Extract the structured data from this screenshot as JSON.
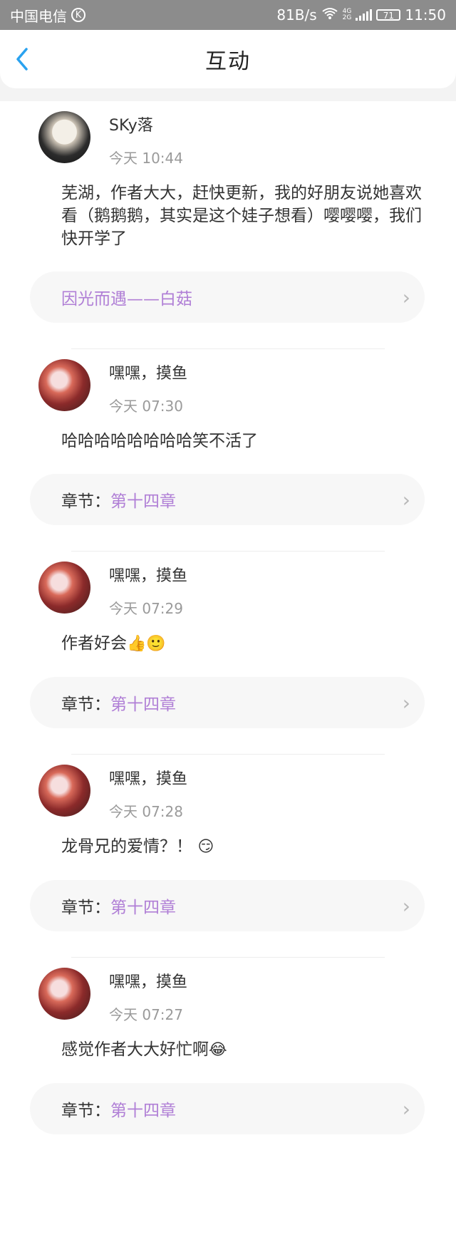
{
  "status_bar": {
    "carrier": "中国电信",
    "carrier_icon": "K",
    "speed": "81B/s",
    "network": "4G",
    "network2": "2G",
    "battery": "71",
    "time": "11:50",
    "colors": {
      "background": "#8c8c8c",
      "text": "#ffffff"
    }
  },
  "header": {
    "title": "互动",
    "back_icon": "chevron-left-icon",
    "accent": "#2aa2ef"
  },
  "comments": [
    {
      "user": "SKy落",
      "time": "今天 10:44",
      "text": "芜湖，作者大大，赶快更新，我的好朋友说她喜欢看（鹅鹅鹅，其实是这个娃子想看）嘤嘤嘤，我们快开学了",
      "link_label": "",
      "link_value": "因光而遇——白菇"
    },
    {
      "user": "嘿嘿，摸鱼",
      "time": "今天 07:30",
      "text": "哈哈哈哈哈哈哈哈笑不活了",
      "link_label": "章节：",
      "link_value": "第十四章"
    },
    {
      "user": "嘿嘿，摸鱼",
      "time": "今天 07:29",
      "text": "作者好会",
      "emoji": "👍🙂",
      "link_label": "章节：",
      "link_value": "第十四章"
    },
    {
      "user": "嘿嘿，摸鱼",
      "time": "今天 07:28",
      "text": "龙骨兄的爱情？！",
      "emoji": "😏",
      "link_label": "章节：",
      "link_value": "第十四章"
    },
    {
      "user": "嘿嘿，摸鱼",
      "time": "今天 07:27",
      "text": "感觉作者大大好忙啊",
      "emoji": "😂",
      "link_label": "章节：",
      "link_value": "第十四章"
    }
  ],
  "colors": {
    "link_value": "#b07fd6",
    "muted": "#9a9a9a",
    "card_bg": "#f7f7f7"
  }
}
